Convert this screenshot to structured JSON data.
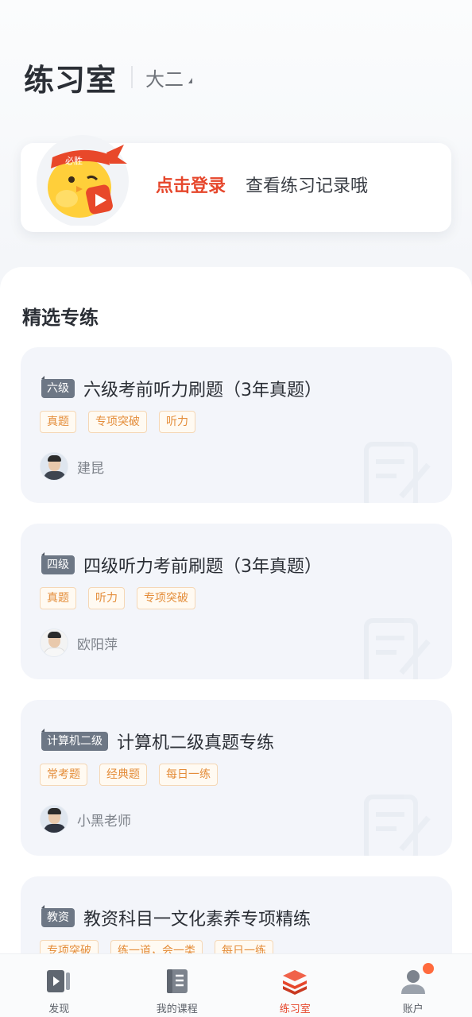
{
  "header": {
    "title": "练习室",
    "grade": "大二"
  },
  "login": {
    "link": "点击登录",
    "subtitle": "查看练习记录哦",
    "mascot_band_text": "必胜"
  },
  "section": {
    "title": "精选专练"
  },
  "courses": [
    {
      "badge": "六级",
      "title": "六级考前听力刷题（3年真题）",
      "tags": [
        "真题",
        "专项突破",
        "听力"
      ],
      "teacher": "建昆"
    },
    {
      "badge": "四级",
      "title": "四级听力考前刷题（3年真题）",
      "tags": [
        "真题",
        "听力",
        "专项突破"
      ],
      "teacher": "欧阳萍"
    },
    {
      "badge": "计算机二级",
      "title": "计算机二级真题专练",
      "tags": [
        "常考题",
        "经典题",
        "每日一练"
      ],
      "teacher": "小黑老师"
    },
    {
      "badge": "教资",
      "title": "教资科目一文化素养专项精练",
      "tags": [
        "专项突破",
        "练一道，会一类",
        "每日一练"
      ],
      "teacher": ""
    }
  ],
  "tabbar": {
    "items": [
      {
        "label": "发现",
        "icon": "discover-icon"
      },
      {
        "label": "我的课程",
        "icon": "book-icon"
      },
      {
        "label": "练习室",
        "icon": "stack-icon"
      },
      {
        "label": "账户",
        "icon": "account-icon"
      }
    ],
    "active": "练习室"
  },
  "colors": {
    "accent": "#e6472c",
    "tag_text": "#e48d3a",
    "badge_bg": "#6d7785",
    "card_bg": "#f3f5fa"
  }
}
